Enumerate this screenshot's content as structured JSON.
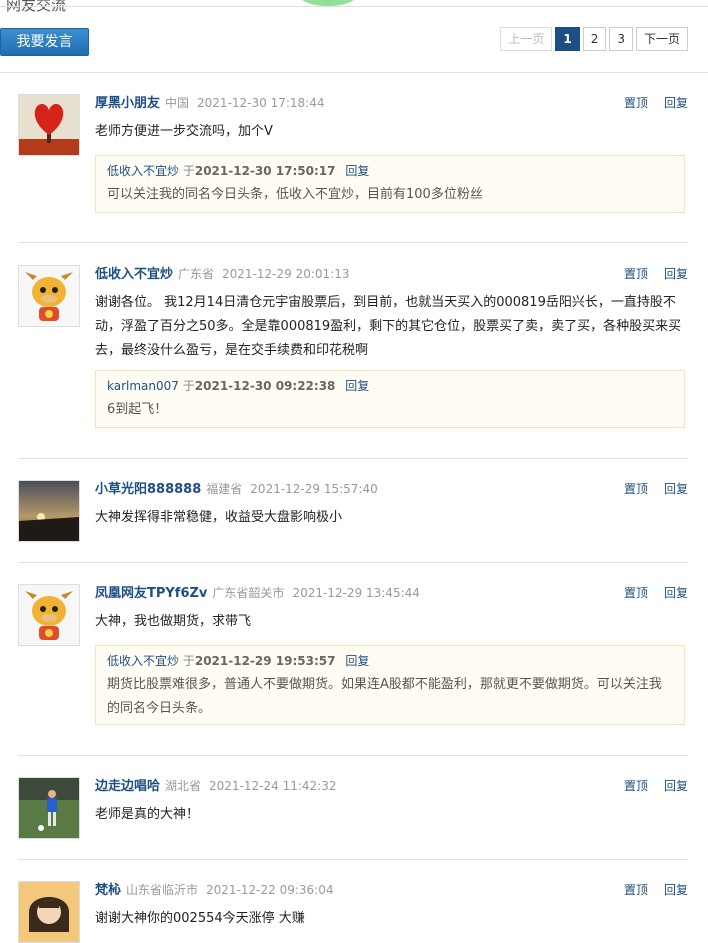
{
  "header": {
    "title": "网友交流",
    "post_button": "我要发言"
  },
  "pager": {
    "prev": "上一页",
    "pages": [
      "1",
      "2",
      "3"
    ],
    "current": "1",
    "next": "下一页"
  },
  "comments": [
    {
      "user": "厚黑小朋友",
      "location": "中国",
      "time": "2021-12-30 17:18:44",
      "pin": "置顶",
      "reply_action": "回复",
      "text": "老师方便进一步交流吗，加个V",
      "reply": {
        "user": "低收入不宜炒",
        "prefix": "于",
        "time": "2021-12-30 17:50:17",
        "action": "回复",
        "text": "可以关注我的同名今日头条，低收入不宜炒，目前有100多位粉丝"
      }
    },
    {
      "user": "低收入不宜炒",
      "location": "广东省",
      "time": "2021-12-29 20:01:13",
      "pin": "置顶",
      "reply_action": "回复",
      "text": "谢谢各位。 我12月14日清仓元宇宙股票后，到目前，也就当天买入的000819岳阳兴长，一直持股不动，浮盈了百分之50多。全是靠000819盈利，剩下的其它仓位，股票买了卖，卖了买，各种股买来买去，最终没什么盈亏，是在交手续费和印花税啊",
      "reply": {
        "user": "karlman007",
        "prefix": "于",
        "time": "2021-12-30 09:22:38",
        "action": "回复",
        "text": "6到起飞！"
      }
    },
    {
      "user": "小草光阳888888",
      "location": "福建省",
      "time": "2021-12-29 15:57:40",
      "pin": "置顶",
      "reply_action": "回复",
      "text": "大神发挥得非常稳健，收益受大盘影响极小"
    },
    {
      "user": "凤凰网友TPYf6Zv",
      "location": "广东省韶关市",
      "time": "2021-12-29 13:45:44",
      "pin": "置顶",
      "reply_action": "回复",
      "text": "大神，我也做期货，求带飞",
      "reply": {
        "user": "低收入不宜炒",
        "prefix": "于",
        "time": "2021-12-29 19:53:57",
        "action": "回复",
        "text": "期货比股票难很多，普通人不要做期货。如果连A股都不能盈利，那就更不要做期货。可以关注我的同名今日头条。"
      }
    },
    {
      "user": "边走边唱哈",
      "location": "湖北省",
      "time": "2021-12-24 11:42:32",
      "pin": "置顶",
      "reply_action": "回复",
      "text": "老师是真的大神！"
    },
    {
      "user": "梵杺",
      "location": "山东省临沂市",
      "time": "2021-12-22 09:36:04",
      "pin": "置顶",
      "reply_action": "回复",
      "text": "谢谢大神你的002554今天涨停 大赚"
    }
  ]
}
